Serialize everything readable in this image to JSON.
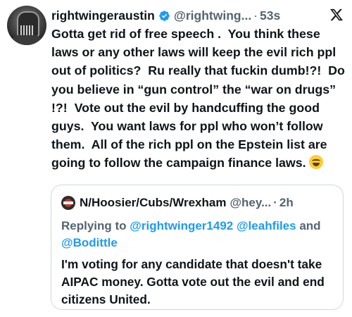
{
  "tweet": {
    "display_name": "rightwingeraustin",
    "handle": "@rightwing...",
    "separator": "·",
    "time": "53s",
    "text": "Gotta get rid of free speech .  You think these laws or any other laws will keep the evil rich ppl  out of politics?  Ru really that fuckin dumb!?!  Do you believe in “gun control” the “war on drugs” !?!  Vote out the evil by handcuffing the good guys.  You want laws for ppl who won’t follow them.  All of the rich ppl on the Epstein list are going to follow the campaign finance laws.",
    "emoji": "face-with-tears-of-joy",
    "icons": {
      "verified": "verified-badge-icon",
      "platform": "x-logo-icon"
    },
    "colors": {
      "text": "#0f1419",
      "secondary": "#536471",
      "verified": "#1d9bf0"
    }
  },
  "quoted": {
    "display_name": "N/Hoosier/Cubs/Wrexham",
    "handle": "@hey...",
    "separator": "·",
    "time": "2h",
    "replying_prefix": "Replying to",
    "mention_1": "@rightwinger1492",
    "mention_2": "@leahfiles",
    "conjunction": "and",
    "mention_3": "@Bodittle",
    "text": "I'm voting for any candidate that doesn't take AIPAC money. Gotta vote out the evil and end citizens United.",
    "colors": {
      "mention": "#1d9bf0",
      "border": "#cfd9de"
    }
  }
}
